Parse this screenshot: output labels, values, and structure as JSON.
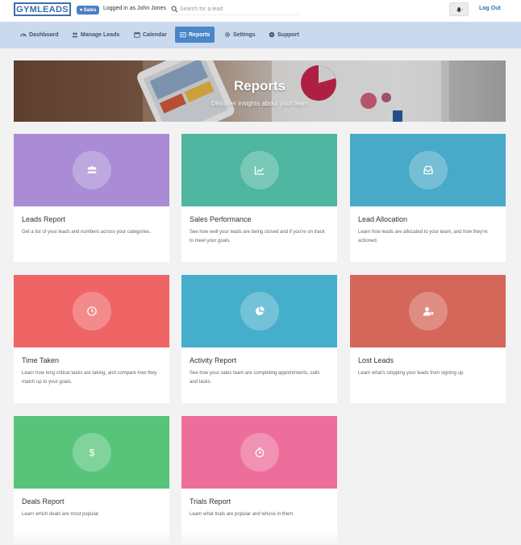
{
  "header": {
    "logo_text": "GYMLEADS",
    "role_badge": "▾ Sales",
    "logged_in_text": "Logged in as John Jones",
    "search_placeholder": "Search for a lead",
    "logout_label": "Log Out"
  },
  "nav": {
    "items": [
      {
        "label": "Dashboard",
        "icon": "dashboard-icon"
      },
      {
        "label": "Manage Leads",
        "icon": "users-icon"
      },
      {
        "label": "Calendar",
        "icon": "calendar-icon"
      },
      {
        "label": "Reports",
        "icon": "reports-icon",
        "active": true
      },
      {
        "label": "Settings",
        "icon": "gear-icon"
      },
      {
        "label": "Support",
        "icon": "help-icon"
      }
    ]
  },
  "banner": {
    "title": "Reports",
    "subtitle": "Discover insights about your team"
  },
  "reports": [
    {
      "title": "Leads Report",
      "description": "Get a list of your leads and numbers across your categories.",
      "color": "#a98bd6",
      "icon": "users-icon"
    },
    {
      "title": "Sales Performance",
      "description": "See how well your leads are being closed and if you're on track to meet your goals.",
      "color": "#4eb6a1",
      "icon": "line-chart-icon"
    },
    {
      "title": "Lead Allocation",
      "description": "Learn how leads are allocated to your team, and how they're actioned.",
      "color": "#48a9c9",
      "icon": "inbox-icon"
    },
    {
      "title": "Time Taken",
      "description": "Learn how long critical tasks are taking, and compare how they match up to your goals.",
      "color": "#ef6566",
      "icon": "clock-icon"
    },
    {
      "title": "Activity Report",
      "description": "See how your sales team are completing appointments, calls and tasks.",
      "color": "#45aecb",
      "icon": "pie-chart-icon"
    },
    {
      "title": "Lost Leads",
      "description": "Learn what's stopping your leads from signing up.",
      "color": "#d5675a",
      "icon": "user-remove-icon"
    },
    {
      "title": "Deals Report",
      "description": "Learn which deals are most popular.",
      "color": "#57c47a",
      "icon": "dollar-icon"
    },
    {
      "title": "Trials Report",
      "description": "Learn what trials are popular and whose in them.",
      "color": "#ee6e9b",
      "icon": "stopwatch-icon"
    }
  ]
}
